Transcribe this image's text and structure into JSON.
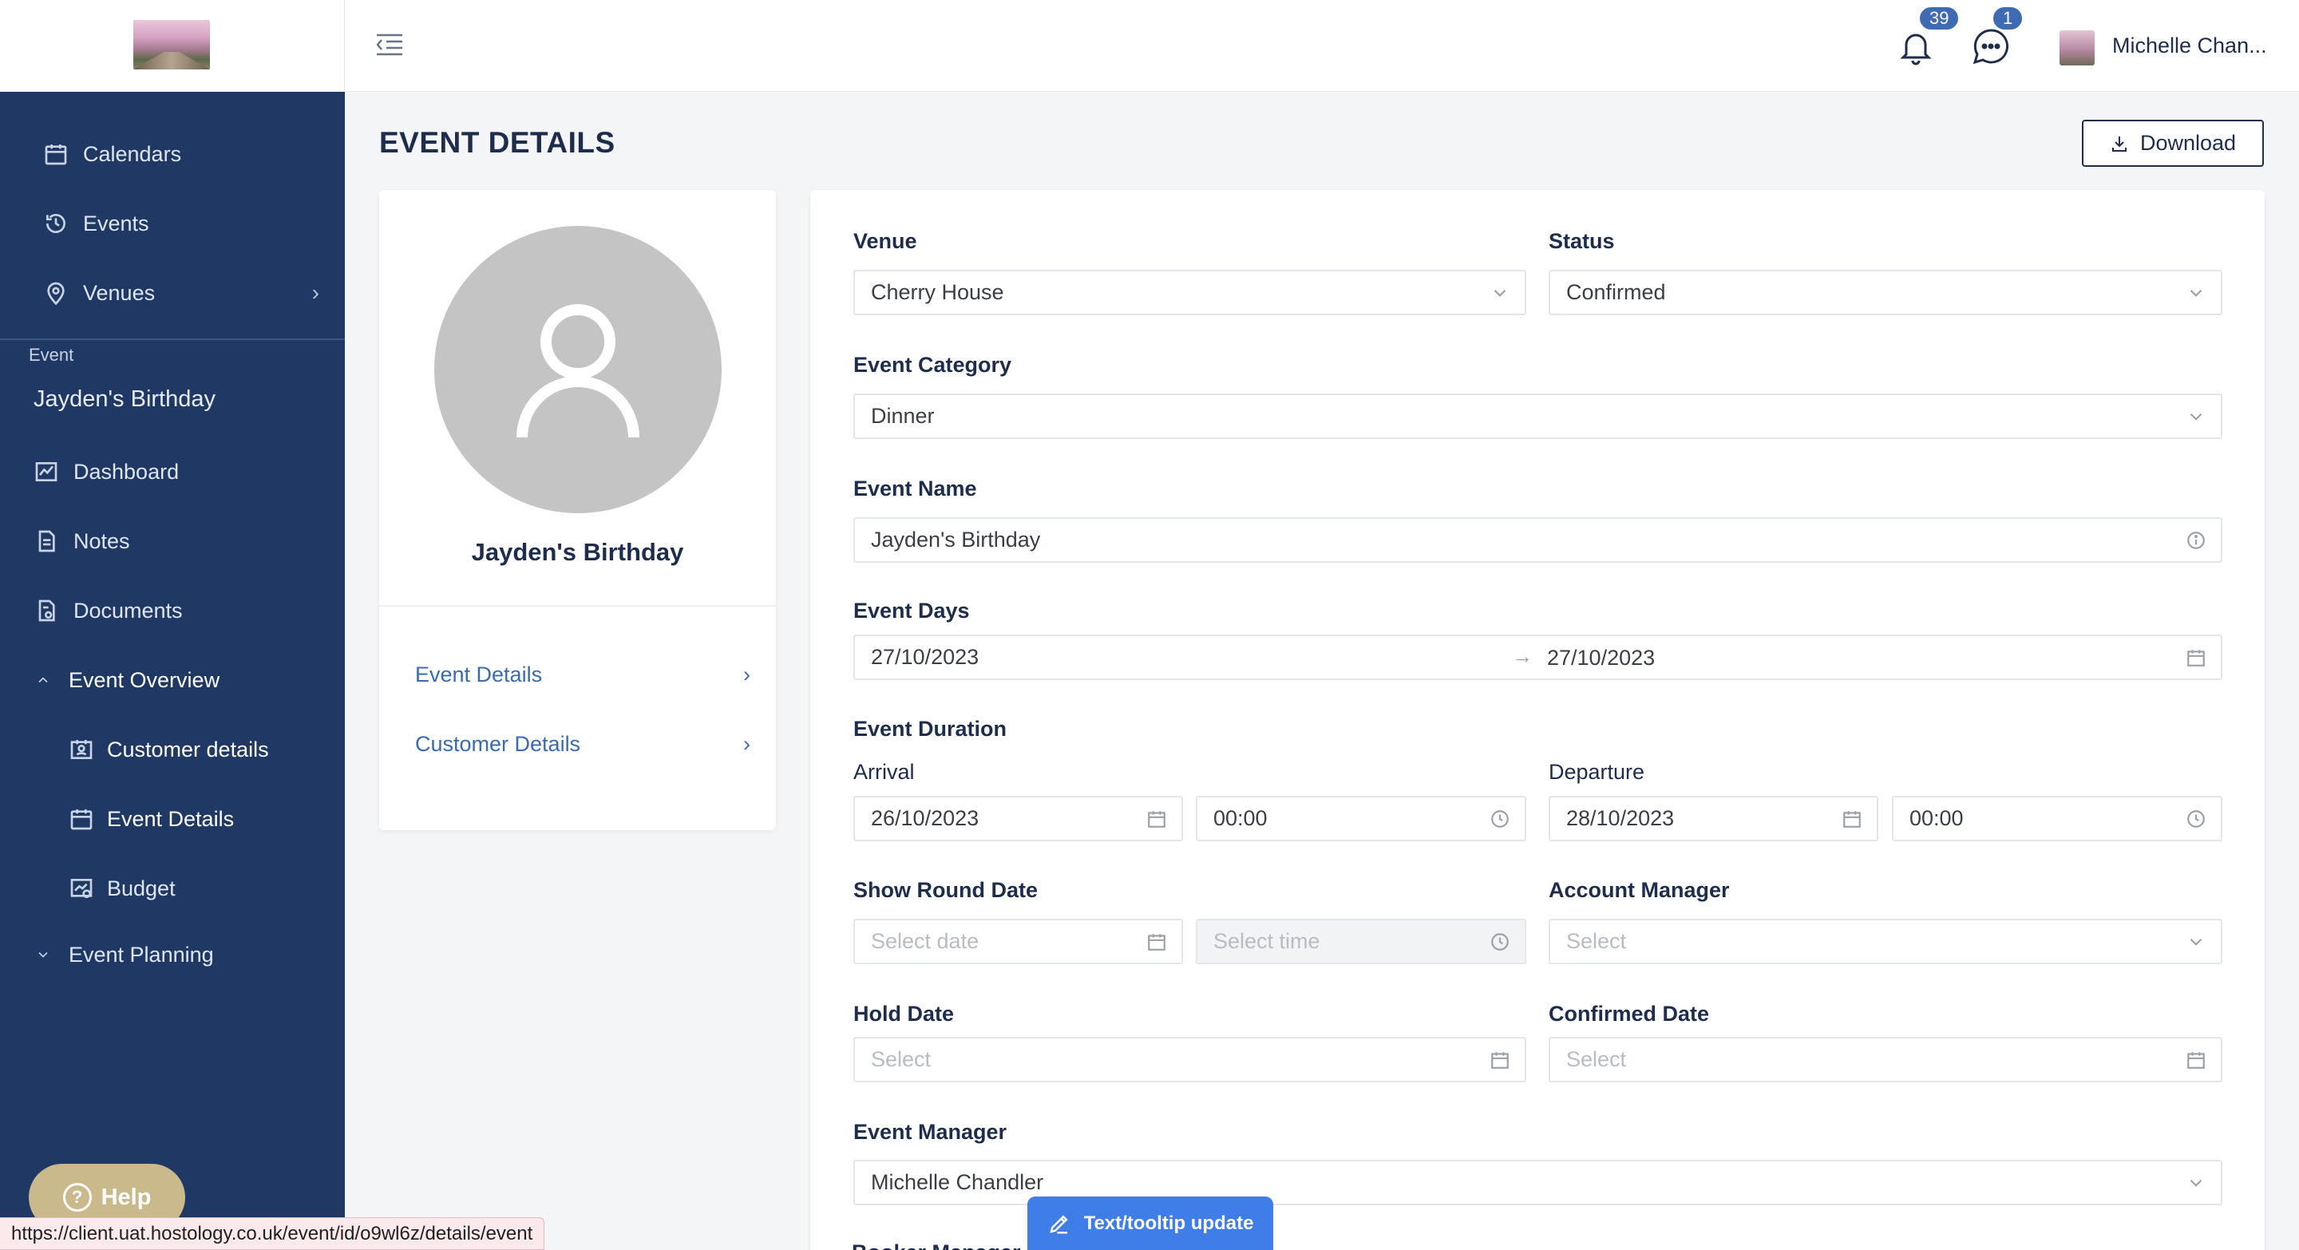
{
  "sidebar": {
    "items": [
      {
        "label": "Calendars",
        "icon": "calendar-icon"
      },
      {
        "label": "Events",
        "icon": "clock-history-icon"
      },
      {
        "label": "Venues",
        "icon": "map-pin-icon"
      }
    ],
    "section_label": "Event",
    "section_title": "Jayden's Birthday",
    "event_items": [
      {
        "label": "Dashboard",
        "icon": "chart-icon"
      },
      {
        "label": "Notes",
        "icon": "note-icon"
      },
      {
        "label": "Documents",
        "icon": "documents-icon"
      },
      {
        "label": "Event Overview",
        "icon": "chevron-up-icon"
      },
      {
        "label": "Customer details",
        "icon": "contact-card-icon"
      },
      {
        "label": "Event Details",
        "icon": "calendar-icon"
      },
      {
        "label": "Budget",
        "icon": "budget-icon"
      },
      {
        "label": "Event Planning",
        "icon": "chevron-down-icon"
      }
    ],
    "help_label": "Help"
  },
  "topbar": {
    "notifications_count": "39",
    "messages_count": "1",
    "user_name": "Michelle Chan..."
  },
  "page": {
    "title": "EVENT DETAILS",
    "download_label": "Download"
  },
  "profile": {
    "name": "Jayden's Birthday",
    "links": [
      "Event Details",
      "Customer Details"
    ]
  },
  "form": {
    "venue": {
      "label": "Venue",
      "value": "Cherry House"
    },
    "status": {
      "label": "Status",
      "value": "Confirmed"
    },
    "category": {
      "label": "Event Category",
      "value": "Dinner"
    },
    "name": {
      "label": "Event Name",
      "value": "Jayden's Birthday"
    },
    "days": {
      "label": "Event Days",
      "start": "27/10/2023",
      "end": "27/10/2023"
    },
    "duration": {
      "label": "Event Duration",
      "arrival_label": "Arrival",
      "arrival_date": "26/10/2023",
      "arrival_time": "00:00",
      "departure_label": "Departure",
      "departure_date": "28/10/2023",
      "departure_time": "00:00"
    },
    "show_round": {
      "label": "Show Round Date",
      "date_placeholder": "Select date",
      "time_placeholder": "Select time"
    },
    "account_manager": {
      "label": "Account Manager",
      "placeholder": "Select"
    },
    "hold_date": {
      "label": "Hold Date",
      "placeholder": "Select"
    },
    "confirmed_date": {
      "label": "Confirmed Date",
      "placeholder": "Select"
    },
    "event_manager": {
      "label": "Event Manager",
      "value": "Michelle Chandler"
    },
    "next_label": "Booker Manager"
  },
  "status_bar": {
    "url": "https://client.uat.hostology.co.uk/event/id/o9wl6z/details/event"
  },
  "tooltip_update": {
    "label": "Text/tooltip update"
  }
}
